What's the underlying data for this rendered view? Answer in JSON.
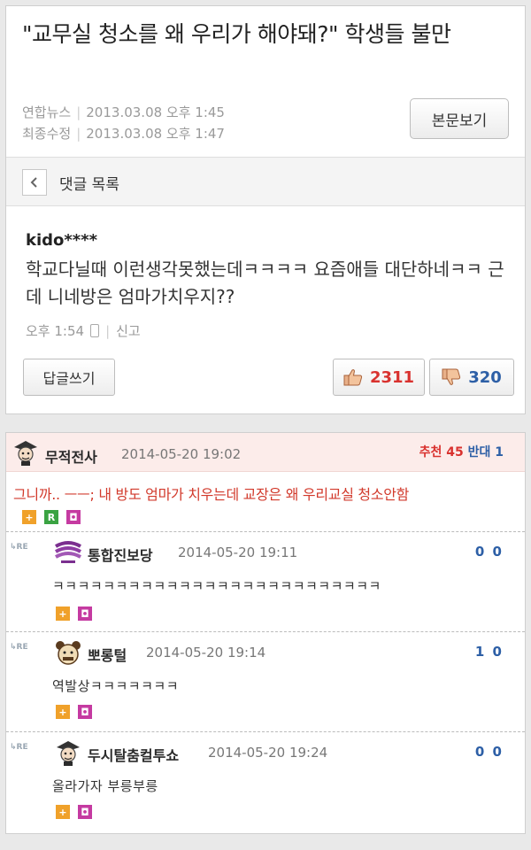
{
  "article": {
    "title": "\"교무실 청소를 왜 우리가 해야돼?\" 학생들 불만",
    "source": "연합뉴스",
    "published": "2013.03.08 오후 1:45",
    "modified_label": "최종수정",
    "modified": "2013.03.08 오후 1:47",
    "view_button": "본문보기"
  },
  "comments_header": {
    "back_icon": "chevron-left-icon",
    "title": "댓글 목록"
  },
  "comment": {
    "user": "kido****",
    "text": "학교다닐때 이런생각못했는데ㅋㅋㅋㅋ 요즘애들 대단하네ㅋㅋ 근데 니네방은 엄마가치우지??",
    "time": "오후 1:54",
    "report": "신고",
    "reply_button": "답글쓰기",
    "likes": "2311",
    "dislikes": "320"
  },
  "forum": {
    "main": {
      "nick": "무적전사",
      "date": "2014-05-20 19:02",
      "recommend_label": "추천",
      "recommend": "45",
      "oppose_label": "반대",
      "oppose": "1",
      "text": "그니까.. ㅡㅡ; 내 방도 엄마가 치우는데 교장은 왜 우리교실 청소안함"
    },
    "re_label": "RE",
    "replies": [
      {
        "nick": "통합진보당",
        "date": "2014-05-20 19:11",
        "score": "0 0",
        "text": "ㅋㅋㅋㅋㅋㅋㅋㅋㅋㅋㅋㅋㅋㅋㅋㅋㅋㅋㅋㅋㅋㅋㅋㅋㅋㅋ"
      },
      {
        "nick": "뽀롱털",
        "date": "2014-05-20 19:14",
        "score": "1 0",
        "text": "역발상ㅋㅋㅋㅋㅋㅋㅋ"
      },
      {
        "nick": "두시탈춤컬투쇼",
        "date": "2014-05-20 19:24",
        "score": "0 0",
        "text": "올라가자 부릉부릉"
      }
    ],
    "colors": {
      "accent_red": "#d23a2c",
      "accent_blue": "#2d5fa6",
      "header_pink": "#fcecea"
    }
  }
}
